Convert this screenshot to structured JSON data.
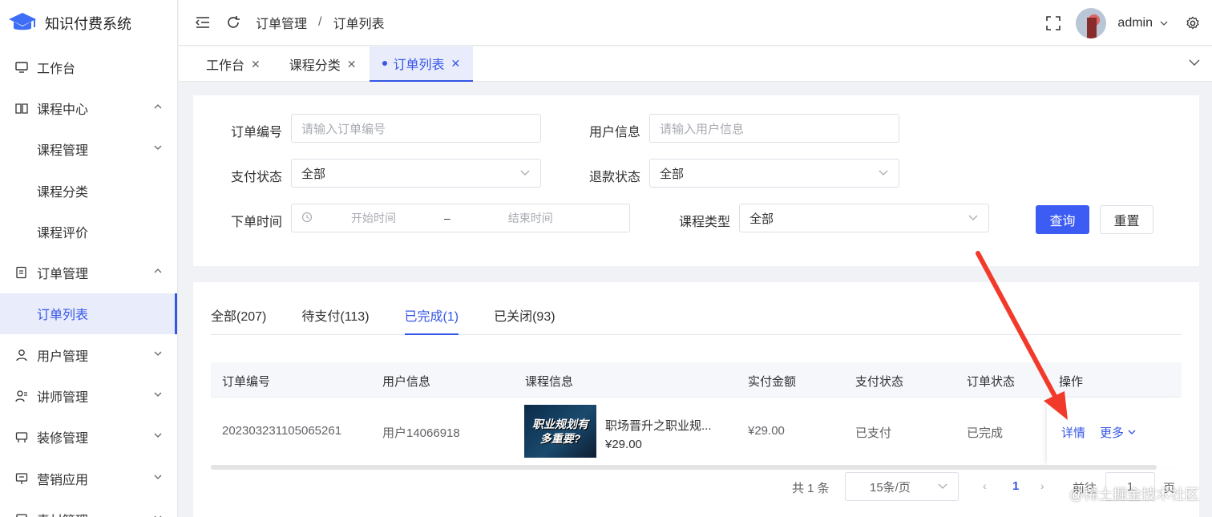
{
  "app": {
    "title": "知识付费系统"
  },
  "sidebar": {
    "items": [
      {
        "label": "工作台",
        "icon": "monitor-icon",
        "expandable": false
      },
      {
        "label": "课程中心",
        "icon": "book-icon",
        "expandable": true,
        "expanded": true
      },
      {
        "label": "课程管理",
        "sub": true,
        "expandable": true
      },
      {
        "label": "课程分类",
        "sub": true
      },
      {
        "label": "课程评价",
        "sub": true
      },
      {
        "label": "订单管理",
        "icon": "order-icon",
        "expandable": true,
        "expanded": true
      },
      {
        "label": "订单列表",
        "sub": true,
        "active": true
      },
      {
        "label": "用户管理",
        "icon": "user-icon",
        "expandable": true
      },
      {
        "label": "讲师管理",
        "icon": "teacher-icon",
        "expandable": true
      },
      {
        "label": "装修管理",
        "icon": "decor-icon",
        "expandable": true
      },
      {
        "label": "营销应用",
        "icon": "marketing-icon",
        "expandable": true
      },
      {
        "label": "素材管理",
        "icon": "material-icon",
        "expandable": true
      }
    ]
  },
  "header": {
    "breadcrumb": [
      "订单管理",
      "订单列表"
    ],
    "user": "admin"
  },
  "tags": [
    {
      "label": "工作台",
      "active": false
    },
    {
      "label": "课程分类",
      "active": false
    },
    {
      "label": "订单列表",
      "active": true
    }
  ],
  "filters": {
    "order_no": {
      "label": "订单编号",
      "placeholder": "请输入订单编号"
    },
    "user_info": {
      "label": "用户信息",
      "placeholder": "请输入用户信息"
    },
    "pay_status": {
      "label": "支付状态",
      "value": "全部"
    },
    "refund_status": {
      "label": "退款状态",
      "value": "全部"
    },
    "order_time": {
      "label": "下单时间",
      "start_placeholder": "开始时间",
      "separator": "–",
      "end_placeholder": "结束时间"
    },
    "course_type": {
      "label": "课程类型",
      "value": "全部"
    },
    "search_label": "查询",
    "reset_label": "重置"
  },
  "status_tabs": [
    {
      "label": "全部(207)",
      "active": false
    },
    {
      "label": "待支付(113)",
      "active": false
    },
    {
      "label": "已完成(1)",
      "active": true
    },
    {
      "label": "已关闭(93)",
      "active": false
    }
  ],
  "table": {
    "columns": [
      "订单编号",
      "用户信息",
      "课程信息",
      "实付金额",
      "支付状态",
      "订单状态",
      "操作"
    ],
    "rows": [
      {
        "order_no": "202303231105065261",
        "user": "用户14066918",
        "course_title": "职场晋升之职业规...",
        "course_price": "¥29.00",
        "course_image_text": [
          "职业规划有",
          "多重要?"
        ],
        "paid": "¥29.00",
        "pay_status": "已支付",
        "order_status": "已完成",
        "detail_label": "详情",
        "more_label": "更多"
      }
    ]
  },
  "pagination": {
    "total": "共 1 条",
    "page_size": "15条/页",
    "current_page": "1",
    "goto_label": "前往",
    "goto_value": "1",
    "page_suffix": "页"
  },
  "watermark": "@稀土掘金技术社区",
  "colors": {
    "accent": "#3656e5",
    "primary_button": "#3d5cf4",
    "arrow": "#f23a2a"
  }
}
